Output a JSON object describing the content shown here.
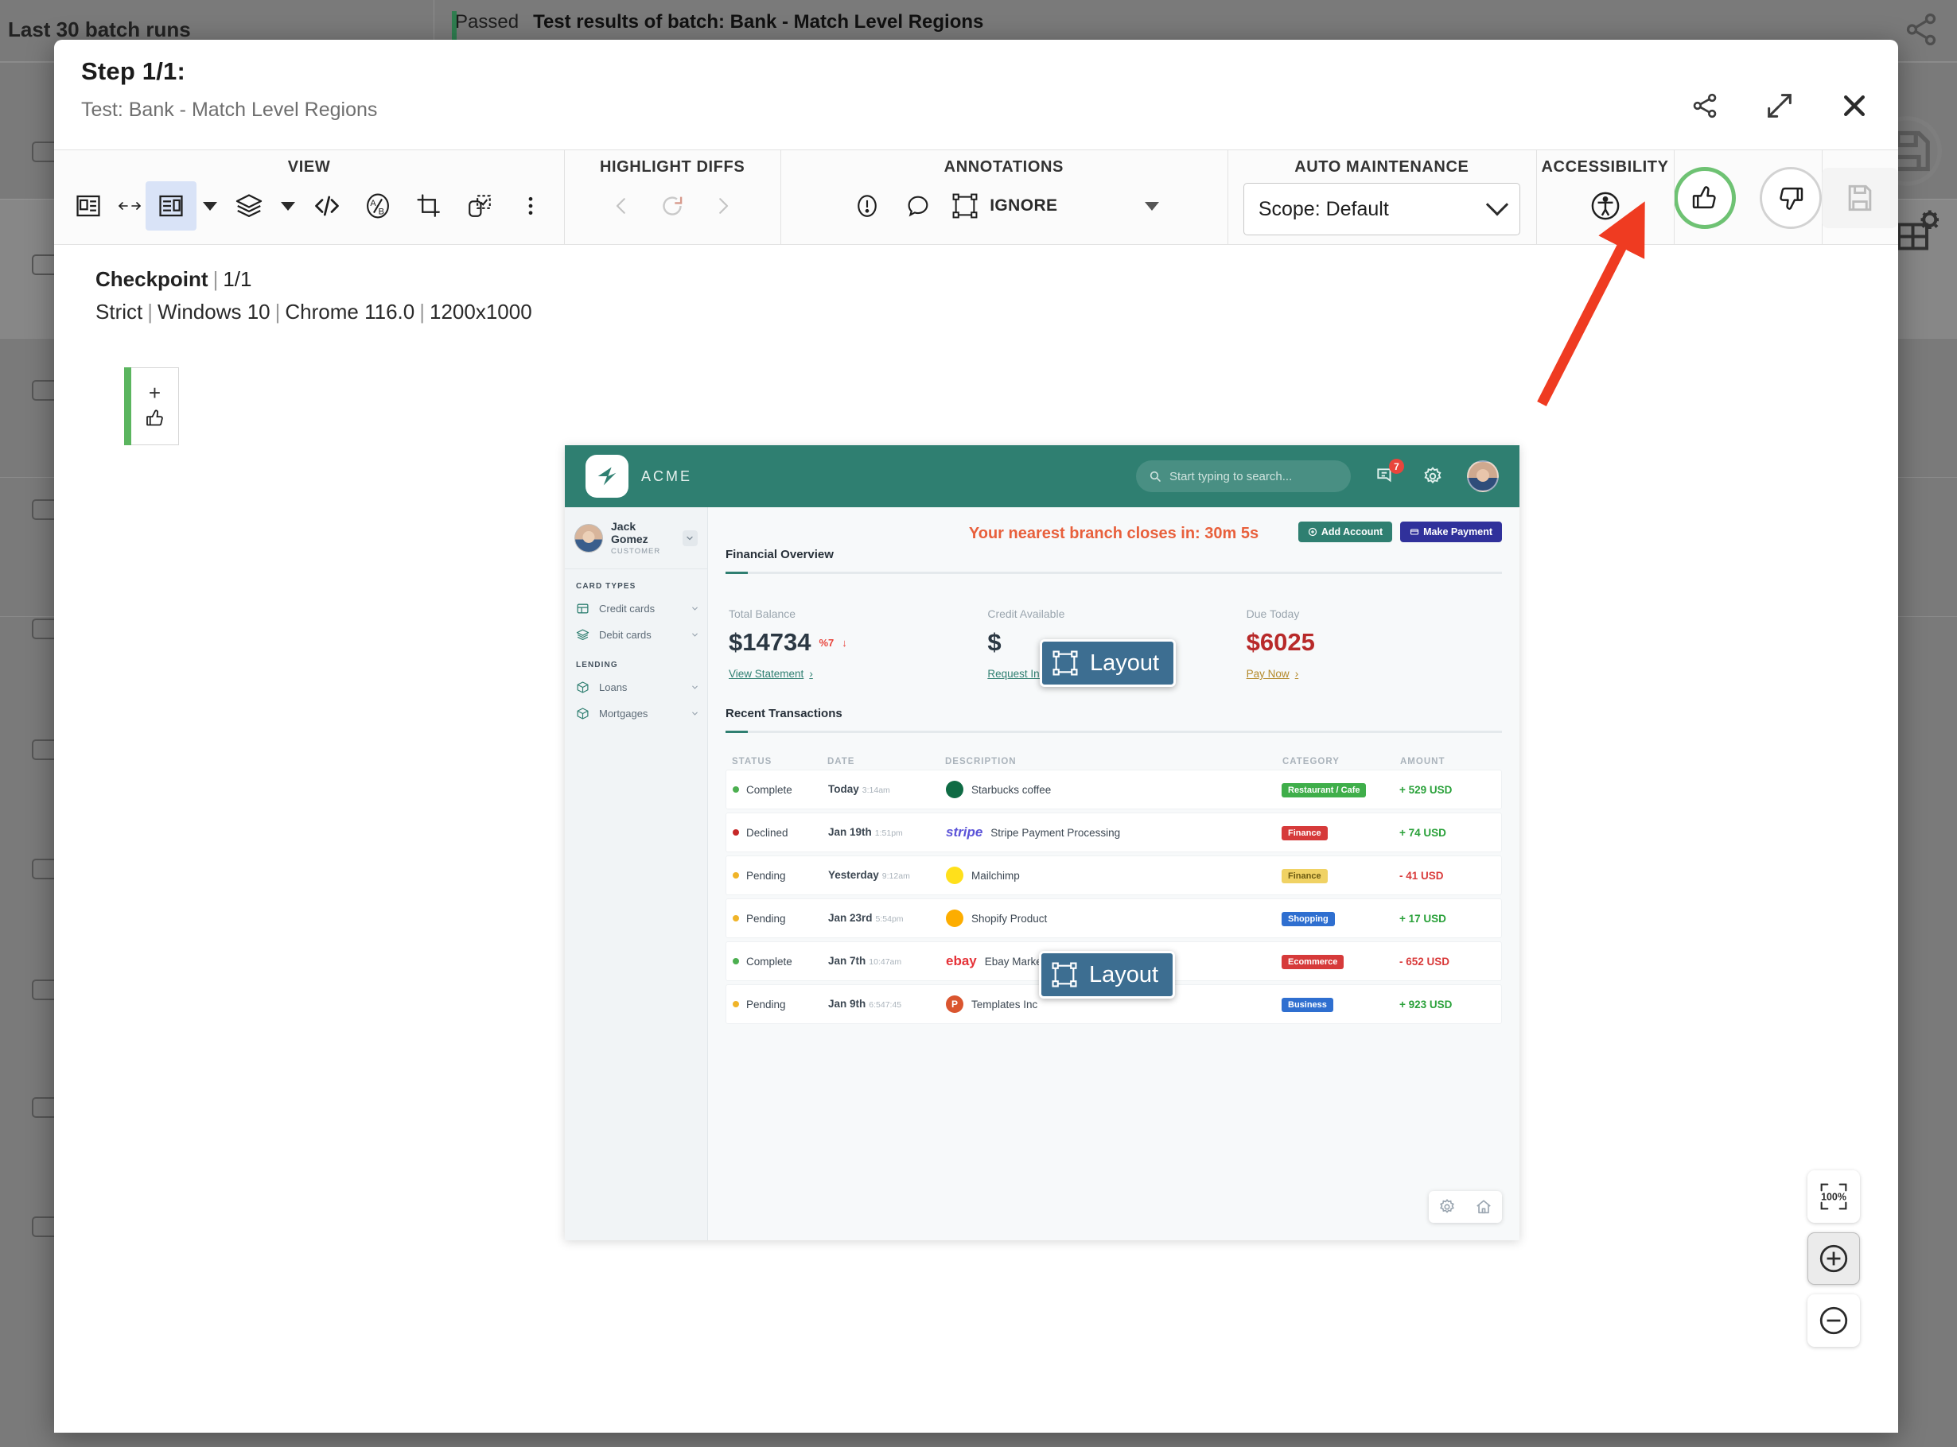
{
  "background": {
    "left_panel_title": "Last 30 batch runs",
    "status": "Passed",
    "batch_title": "Test results of batch:  Bank - Match Level Regions",
    "icons": {
      "share": "share-icon",
      "save": "save-icon",
      "table_settings": "table-gear-icon"
    }
  },
  "modal": {
    "step_title": "Step 1/1:",
    "test_label": "Test: Bank - Match Level Regions",
    "header_actions": [
      {
        "name": "share-icon",
        "label": "Share"
      },
      {
        "name": "expand-icon",
        "label": "Expand"
      },
      {
        "name": "close-icon",
        "label": "Close"
      }
    ],
    "toolbar": {
      "groups": [
        {
          "name": "view",
          "label": "VIEW"
        },
        {
          "name": "highlight-diffs",
          "label": "HIGHLIGHT DIFFS"
        },
        {
          "name": "annotations",
          "label": "ANNOTATIONS"
        },
        {
          "name": "auto-maintenance",
          "label": "AUTO MAINTENANCE"
        },
        {
          "name": "accessibility",
          "label": "ACCESSIBILITY"
        }
      ],
      "view_buttons": [
        {
          "name": "side-by-side-icon",
          "active": false
        },
        {
          "name": "single-view-icon",
          "active": true
        },
        {
          "name": "layers-icon",
          "active": false
        },
        {
          "name": "code-icon",
          "active": false
        },
        {
          "name": "ab-compare-icon",
          "active": false
        },
        {
          "name": "crop-icon",
          "active": false
        },
        {
          "name": "select-region-icon",
          "active": false
        },
        {
          "name": "more-options-icon",
          "active": false
        }
      ],
      "diff_buttons": [
        {
          "name": "prev-diff-icon"
        },
        {
          "name": "refresh-diff-icon"
        },
        {
          "name": "next-diff-icon"
        }
      ],
      "annotation_buttons": [
        {
          "name": "alert-icon"
        },
        {
          "name": "comment-icon"
        }
      ],
      "ignore_label": "IGNORE",
      "scope_value": "Scope: Default",
      "accessibility_icon": "accessibility-icon",
      "vote": {
        "thumbs_up": "thumbs-up-icon",
        "thumbs_down": "thumbs-down-icon",
        "accepted": true,
        "accent_color": "#6ec273"
      },
      "save_icon": "save-icon"
    },
    "checkpoint": {
      "label": "Checkpoint",
      "index": "1/1",
      "match_level": "Strict",
      "os": "Windows 10",
      "browser": "Chrome 116.0",
      "viewport": "1200x1000",
      "separator": "|"
    },
    "accept_marker": {
      "plus": "+",
      "icon": "thumbs-up-icon",
      "bar_color": "#5bb55f"
    },
    "zoom_controls": {
      "fit_label": "100%",
      "zoom_in": "zoom-in-icon",
      "zoom_out": "zoom-out-icon"
    },
    "annotations_overlay": [
      {
        "name": "layout-tooltip-credit",
        "label": "Layout"
      },
      {
        "name": "layout-tooltip-transaction",
        "label": "Layout"
      }
    ]
  },
  "screenshot": {
    "brand": "ACME",
    "search_placeholder": "Start typing to search...",
    "notification_count": "7",
    "user": {
      "name": "Jack Gomez",
      "role": "CUSTOMER"
    },
    "sidebar": [
      {
        "section": "CARD TYPES",
        "items": [
          {
            "label": "Credit cards",
            "icon": "card-icon"
          },
          {
            "label": "Debit cards",
            "icon": "layers-icon"
          }
        ]
      },
      {
        "section": "LENDING",
        "items": [
          {
            "label": "Loans",
            "icon": "box-icon"
          },
          {
            "label": "Mortgages",
            "icon": "box-icon"
          }
        ]
      }
    ],
    "banner": "Your nearest branch closes in: 30m 5s",
    "actions": [
      {
        "label": "Add Account",
        "name": "add-account-button",
        "color": "#2f7f71"
      },
      {
        "label": "Make Payment",
        "name": "make-payment-button",
        "color": "#30319b"
      }
    ],
    "overview_title": "Financial Overview",
    "stats": [
      {
        "label": "Total Balance",
        "value": "$14734",
        "delta": "%7",
        "delta_dir": "down",
        "link": "View Statement",
        "link_style": "teal"
      },
      {
        "label": "Credit Available",
        "value": "$",
        "delta": "",
        "link": "Request Increase",
        "link_style": "teal"
      },
      {
        "label": "Due Today",
        "value": "$6025",
        "delta": "",
        "link": "Pay Now",
        "link_style": "amber",
        "value_style": "due"
      }
    ],
    "transactions_title": "Recent Transactions",
    "tx_columns": [
      "STATUS",
      "DATE",
      "DESCRIPTION",
      "CATEGORY",
      "AMOUNT"
    ],
    "transactions": [
      {
        "status": "Complete",
        "status_color": "#4caf50",
        "date": "Today",
        "time": "3:14am",
        "desc": "Starbucks coffee",
        "logo": "starbucks-logo",
        "logo_color": "#0f6b44",
        "logo_text": "",
        "category": "Restaurant / Cafe",
        "cat_color": "#3fae4a",
        "amount": "+ 529 USD",
        "amount_color": "#2aa13a"
      },
      {
        "status": "Declined",
        "status_color": "#c62828",
        "date": "Jan 19th",
        "time": "1:51pm",
        "desc": "Stripe Payment Processing",
        "logo": "stripe-logo",
        "logo_color": "#5b53d8",
        "logo_text": "stripe",
        "category": "Finance",
        "cat_color": "#d63a3a",
        "amount": "+ 74 USD",
        "amount_color": "#2aa13a"
      },
      {
        "status": "Pending",
        "status_color": "#f0b429",
        "date": "Yesterday",
        "time": "9:12am",
        "desc": "Mailchimp",
        "logo": "mailchimp-logo",
        "logo_color": "#ffe01b",
        "logo_text": "",
        "category": "Finance",
        "cat_color": "#f0d264",
        "cat_text_color": "#6b5a12",
        "amount": "- 41 USD",
        "amount_color": "#d93a3a"
      },
      {
        "status": "Pending",
        "status_color": "#f0b429",
        "date": "Jan 23rd",
        "time": "5:54pm",
        "desc": "Shopify Product",
        "logo": "sketch-logo",
        "logo_color": "#fdad00",
        "logo_text": "",
        "category": "Shopping",
        "cat_color": "#2f6fd0",
        "amount": "+ 17 USD",
        "amount_color": "#2aa13a"
      },
      {
        "status": "Complete",
        "status_color": "#4caf50",
        "date": "Jan 7th",
        "time": "10:47am",
        "desc": "Ebay Marketplace",
        "logo": "ebay-logo",
        "logo_color": "#e53238",
        "logo_text": "ebay",
        "category": "Ecommerce",
        "cat_color": "#d63a3a",
        "amount": "- 652 USD",
        "amount_color": "#d93a3a"
      },
      {
        "status": "Pending",
        "status_color": "#f0b429",
        "date": "Jan 9th",
        "time": "6:547:45",
        "desc": "Templates Inc",
        "logo": "product-hunt-logo",
        "logo_color": "#da552f",
        "logo_text": "P",
        "category": "Business",
        "cat_color": "#2f6fd0",
        "amount": "+ 923 USD",
        "amount_color": "#2aa13a"
      }
    ],
    "footer_buttons": [
      {
        "name": "settings-gear-icon"
      },
      {
        "name": "home-icon"
      }
    ]
  }
}
